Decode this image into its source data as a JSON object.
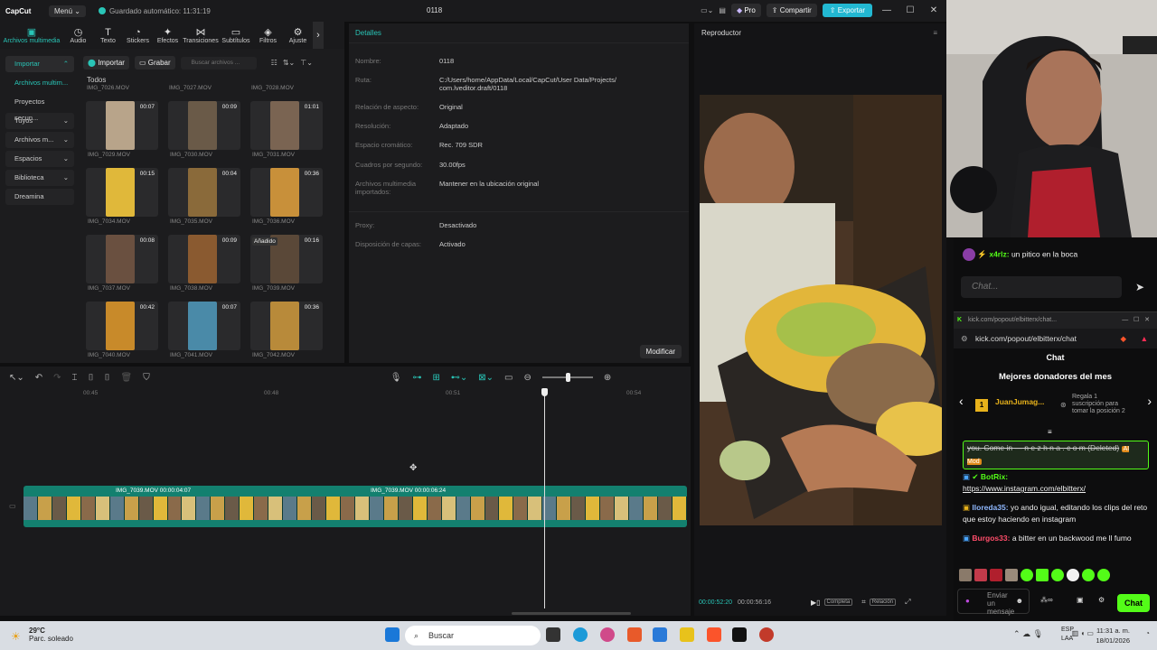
{
  "app": {
    "logo": "CapCut",
    "menu": "Menú",
    "autosave": "Guardado automático: 11:31:19",
    "project": "0118",
    "pro": "Pro",
    "share": "Compartir",
    "export": "Exportar"
  },
  "toolbar": {
    "tools": [
      "Archivos multimedia",
      "Audio",
      "Texto",
      "Stickers",
      "Efectos",
      "Transiciones",
      "Subtítulos",
      "Filtros",
      "Ajuste"
    ]
  },
  "media": {
    "sidebar": [
      "Importar",
      "Archivos multim...",
      "Proyectos secun...",
      "Tuyos",
      "Archivos m...",
      "Espacios",
      "Biblioteca",
      "Dreamina"
    ],
    "import": "Importar",
    "record": "Grabar",
    "search_placeholder": "Buscar archivos ...",
    "all": "Todos",
    "top_names": [
      "IMG_7026.MOV",
      "IMG_7027.MOV",
      "IMG_7028.MOV"
    ],
    "items": [
      {
        "name": "IMG_7029.MOV",
        "dur": "00:07",
        "tag": ""
      },
      {
        "name": "IMG_7030.MOV",
        "dur": "00:09",
        "tag": ""
      },
      {
        "name": "IMG_7031.MOV",
        "dur": "01:01",
        "tag": ""
      },
      {
        "name": "IMG_7034.MOV",
        "dur": "00:15",
        "tag": ""
      },
      {
        "name": "IMG_7035.MOV",
        "dur": "00:04",
        "tag": ""
      },
      {
        "name": "IMG_7036.MOV",
        "dur": "00:36",
        "tag": ""
      },
      {
        "name": "IMG_7037.MOV",
        "dur": "00:08",
        "tag": ""
      },
      {
        "name": "IMG_7038.MOV",
        "dur": "00:09",
        "tag": ""
      },
      {
        "name": "IMG_7039.MOV",
        "dur": "00:16",
        "tag": "Añadido"
      },
      {
        "name": "IMG_7040.MOV",
        "dur": "00:42",
        "tag": ""
      },
      {
        "name": "IMG_7041.MOV",
        "dur": "00:07",
        "tag": ""
      },
      {
        "name": "IMG_7042.MOV",
        "dur": "00:36",
        "tag": ""
      }
    ]
  },
  "details": {
    "title": "Detalles",
    "rows": [
      {
        "label": "Nombre:",
        "value": "0118"
      },
      {
        "label": "Ruta:",
        "value": "C:/Users/home/AppData/Local/CapCut/User Data/Projects/ com.lveditor.draft/0118"
      },
      {
        "label": "Relación de aspecto:",
        "value": "Original"
      },
      {
        "label": "Resolución:",
        "value": "Adaptado"
      },
      {
        "label": "Espacio cromático:",
        "value": "Rec. 709 SDR"
      },
      {
        "label": "Cuadros por segundo:",
        "value": "30.00fps"
      },
      {
        "label": "Archivos multimedia importados:",
        "value": "Mantener en la ubicación original"
      },
      {
        "label": "Proxy:",
        "value": "Desactivado"
      },
      {
        "label": "Disposición de capas:",
        "value": "Activado"
      }
    ],
    "modify": "Modificar"
  },
  "player": {
    "title": "Reproductor",
    "current": "00:00:52:20",
    "total": "00:00:56:16",
    "full": "Completa",
    "ratio": "Relación"
  },
  "timeline": {
    "ticks": [
      "00:45",
      "00:48",
      "00:51",
      "00:54"
    ],
    "clips": [
      {
        "label": "IMG_7039.MOV  00:00:04:07"
      },
      {
        "label": "IMG_7039.MOV  00:00:06:24"
      }
    ]
  },
  "chat_mini": {
    "user": "x4rlz:",
    "text": "un pitico en la boca",
    "placeholder": "Chat..."
  },
  "kick": {
    "tab": "kick.com/popout/elbitterx/chat...",
    "url": "kick.com/popout/elbitterx/chat",
    "title": "Chat",
    "donors_title": "Mejores donadores del mes",
    "donor_name": "JuanJumag...",
    "donor_count": "1",
    "gift_text": "Regala 1 suscripción para tomar la posición 2",
    "messages": [
      {
        "user": "",
        "text": "you. Come in — n e z h n a . c o m (Deleted)",
        "badge": "AI Mod"
      },
      {
        "user": "BotRix:",
        "text": "https://www.instagram.com/elbitterx/"
      },
      {
        "user": "lloreda35:",
        "text": "yo ando igual, editando los clips del reto que estoy haciendo en instagram"
      },
      {
        "user": "Burgos33:",
        "text": "a bitter en un backwood me ll fumo"
      }
    ],
    "send_placeholder": "Enviar un mensaje",
    "chat_button": "Chat"
  },
  "taskbar": {
    "temp": "29°C",
    "weather": "Parc. soleado",
    "search": "Buscar",
    "lang1": "ESP",
    "lang2": "LAA",
    "time": "11:31 a. m.",
    "date": "18/01/2026"
  }
}
